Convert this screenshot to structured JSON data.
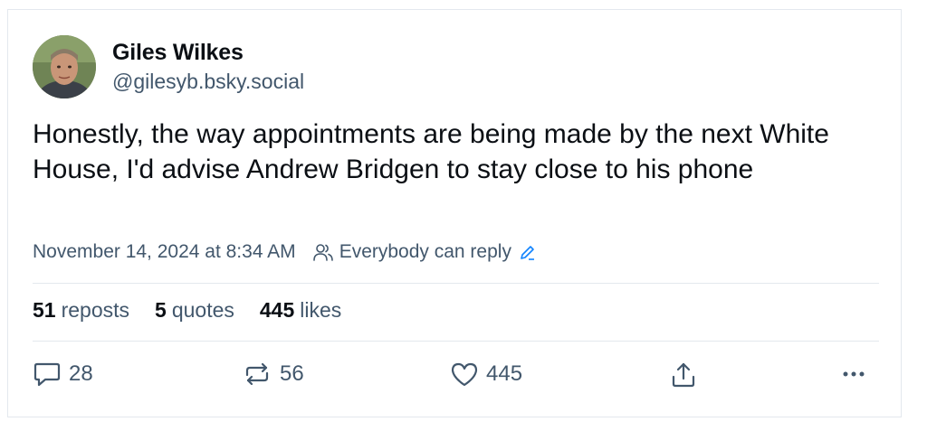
{
  "author": {
    "display_name": "Giles Wilkes",
    "handle": "@gilesyb.bsky.social"
  },
  "post": {
    "text": "Honestly, the way appointments are being made by the next White House, I'd advise Andrew Bridgen to stay close to his phone",
    "timestamp": "November 14, 2024 at 8:34 AM",
    "reply_setting": "Everybody can reply"
  },
  "stats": {
    "reposts_count": "51",
    "reposts_label": "reposts",
    "quotes_count": "5",
    "quotes_label": "quotes",
    "likes_count": "445",
    "likes_label": "likes"
  },
  "actions": {
    "reply_count": "28",
    "repost_count": "56",
    "like_count": "445"
  },
  "icons": [
    "people-icon",
    "pencil-icon",
    "reply-icon",
    "repost-icon",
    "heart-icon",
    "share-icon",
    "more-icon"
  ],
  "colors": {
    "text": "#0b0f14",
    "muted": "#42576c",
    "border": "#e3e8ee",
    "accent": "#1083fe"
  }
}
